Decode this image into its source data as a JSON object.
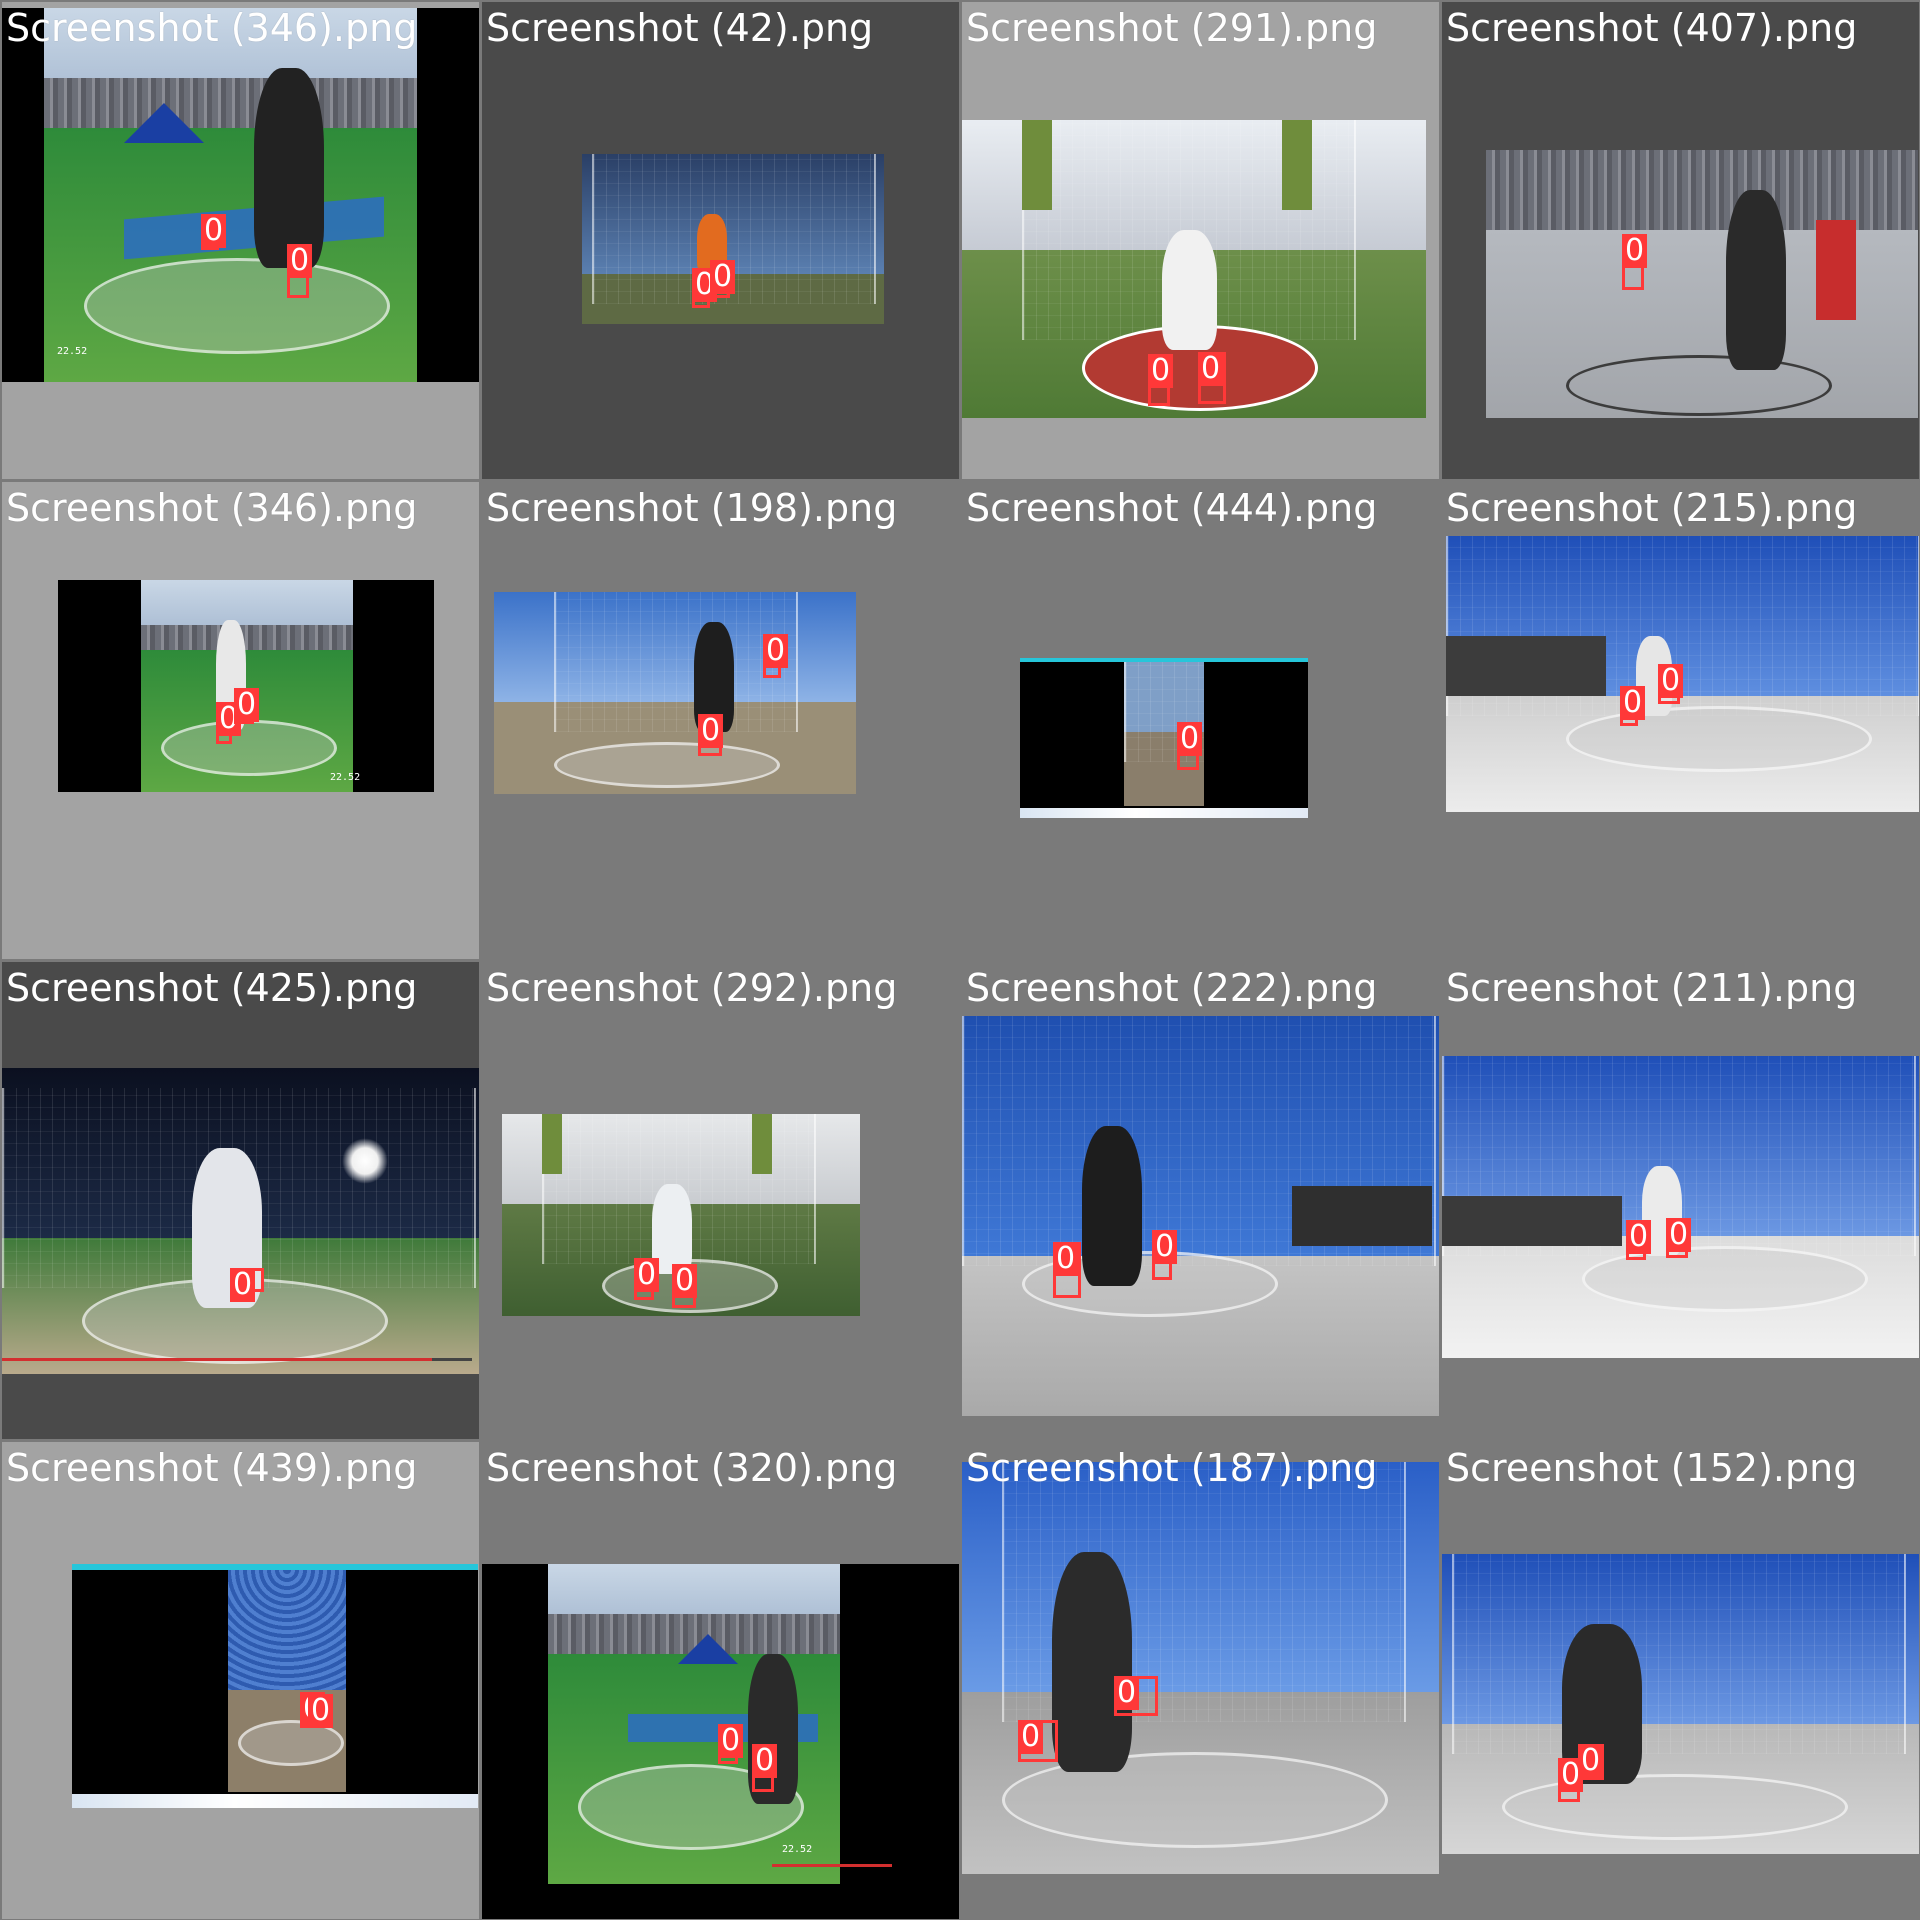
{
  "mosaic": {
    "tiles": [
      {
        "filename": "Screenshot (346).png",
        "detections": [
          "0",
          "0"
        ],
        "hud": "22.52"
      },
      {
        "filename": "Screenshot (42).png",
        "detections": [
          "0",
          "0"
        ]
      },
      {
        "filename": "Screenshot (291).png",
        "detections": [
          "0",
          "0"
        ]
      },
      {
        "filename": "Screenshot (407).png",
        "detections": [
          "0"
        ]
      },
      {
        "filename": "Screenshot (346).png",
        "detections": [
          "0",
          "0"
        ],
        "hud": "22.52"
      },
      {
        "filename": "Screenshot (198).png",
        "detections": [
          "0",
          "0"
        ]
      },
      {
        "filename": "Screenshot (444).png",
        "detections": [
          "0"
        ]
      },
      {
        "filename": "Screenshot (215).png",
        "detections": [
          "0",
          "0"
        ]
      },
      {
        "filename": "Screenshot (425).png",
        "detections": [
          "0"
        ]
      },
      {
        "filename": "Screenshot (292).png",
        "detections": [
          "0",
          "0"
        ]
      },
      {
        "filename": "Screenshot (222).png",
        "detections": [
          "0",
          "0"
        ]
      },
      {
        "filename": "Screenshot (211).png",
        "detections": [
          "0",
          "0"
        ]
      },
      {
        "filename": "Screenshot (439).png",
        "detections": [
          "0",
          "0"
        ]
      },
      {
        "filename": "Screenshot (320).png",
        "detections": [
          "0",
          "0"
        ],
        "hud": "22.52"
      },
      {
        "filename": "Screenshot (187).png",
        "detections": [
          "0",
          "0"
        ]
      },
      {
        "filename": "Screenshot (152).png",
        "detections": [
          "0",
          "0"
        ]
      }
    ]
  },
  "colors": {
    "box": "#ff3838",
    "tile_light": "#a3a3a3",
    "tile_dark": "#4a4a4a",
    "tile_mid": "#7a7a7a"
  }
}
